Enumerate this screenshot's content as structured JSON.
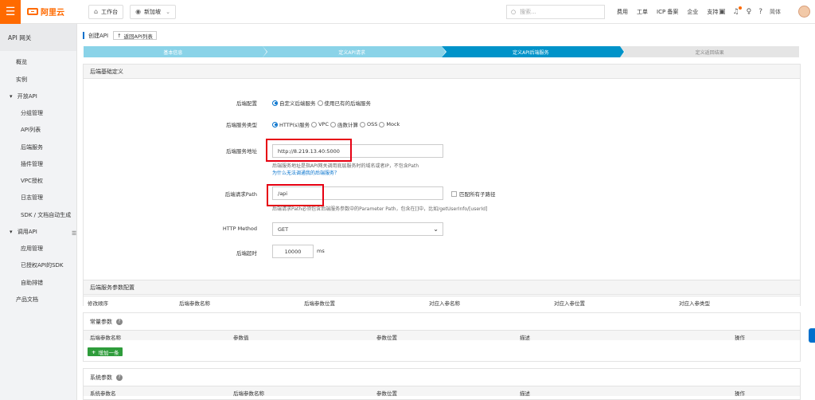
{
  "topbar": {
    "logo_text": "阿里云",
    "workbench_label": "工作台",
    "region_label": "新加坡",
    "search_placeholder": "搜索...",
    "nav": [
      "费用",
      "工单",
      "ICP 备案",
      "企业",
      "支持"
    ],
    "lang_label": "简体"
  },
  "sidebar": {
    "title": "API 网关",
    "items": [
      "概览",
      "实例",
      "开放API",
      "分组管理",
      "API列表",
      "后端服务",
      "插件管理",
      "VPC授权",
      "日志管理",
      "SDK / 文档自动生成",
      "调用API",
      "应用管理",
      "已授权API的SDK",
      "自助排错",
      "产品文档"
    ]
  },
  "breadcrumb": {
    "title": "创建API",
    "back_label": "返回API列表"
  },
  "steps": [
    "基本信息",
    "定义API请求",
    "定义API后端服务",
    "定义返回结果"
  ],
  "backend_section": {
    "title": "后端基础定义",
    "config_label": "后端配置",
    "config_options": [
      "自定义后端服务",
      "使用已有的后端服务"
    ],
    "service_type_label": "后端服务类型",
    "service_type_options": [
      "HTTP(s)服务",
      "VPC",
      "函数计算",
      "OSS",
      "Mock"
    ],
    "address_label": "后端服务地址",
    "address_value": "http://8.219.13.40:5000",
    "address_hint": "后端服务地址是指API网关调用底层服务时的域名或者IP，不包含Path",
    "address_link": "为什么无法调通我的后端服务？",
    "path_label": "后端请求Path",
    "path_value": "/api",
    "match_sub_label": "匹配所有子路径",
    "path_hint": "后端请求Path必须包含后端服务参数中的Parameter Path，包含在[]中，比如/getUserInfo/[userId]",
    "method_label": "HTTP Method",
    "method_value": "GET",
    "timeout_label": "后端超时",
    "timeout_value": "10000",
    "timeout_unit": "ms"
  },
  "param_section": {
    "title": "后端服务参数配置",
    "columns": [
      "修改顺序",
      "后端参数名称",
      "后端参数位置",
      "对应入参名称",
      "对应入参位置",
      "对应入参类型"
    ]
  },
  "const_section": {
    "title": "常量参数",
    "columns": [
      "后端参数名称",
      "参数值",
      "参数位置",
      "描述",
      "操作"
    ],
    "add_label": "增加一条"
  },
  "system_section": {
    "title": "系统参数",
    "columns": [
      "系统参数名",
      "后端参数名称",
      "参数位置",
      "描述",
      "操作"
    ]
  }
}
